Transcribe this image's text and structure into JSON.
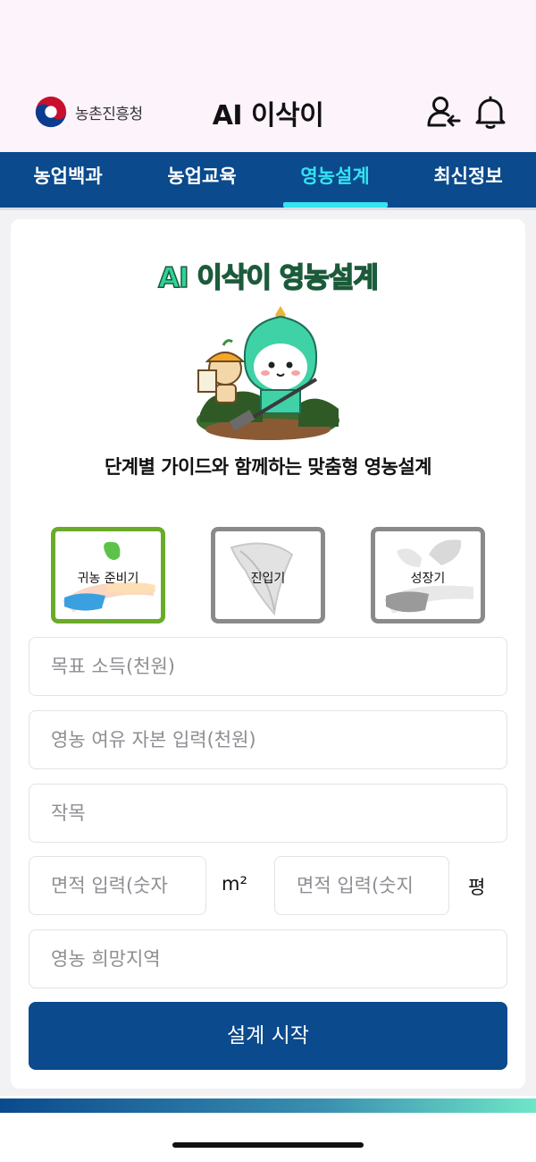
{
  "header": {
    "org_logo_text": "농촌진흥청",
    "title": "AI 이삭이"
  },
  "nav": {
    "tabs": [
      {
        "label": "농업백과"
      },
      {
        "label": "농업교육"
      },
      {
        "label": "영농설계",
        "active": true
      },
      {
        "label": "최신정보"
      }
    ],
    "active_color": "#35e2f0",
    "bg_color": "#0a4a8d"
  },
  "hero": {
    "title": "AI 이삭이 영농설계",
    "subtitle": "단계별 가이드와 함께하는 맞춤형 영농설계"
  },
  "stages": [
    {
      "label": "귀농 준비기",
      "selected": true
    },
    {
      "label": "진입기",
      "selected": false
    },
    {
      "label": "성장기",
      "selected": false
    }
  ],
  "form": {
    "target_income_placeholder": "목표 소득(천원)",
    "capital_placeholder": "영농 여유 자본 입력(천원)",
    "crop_placeholder": "작목",
    "area_m2_placeholder": "면적 입력(숫자",
    "area_m2_unit": "m²",
    "area_pyeong_placeholder": "면적 입력(숫지",
    "area_pyeong_unit": "평",
    "region_placeholder": "영농 희망지역"
  },
  "actions": {
    "start_label": "설계 시작"
  }
}
